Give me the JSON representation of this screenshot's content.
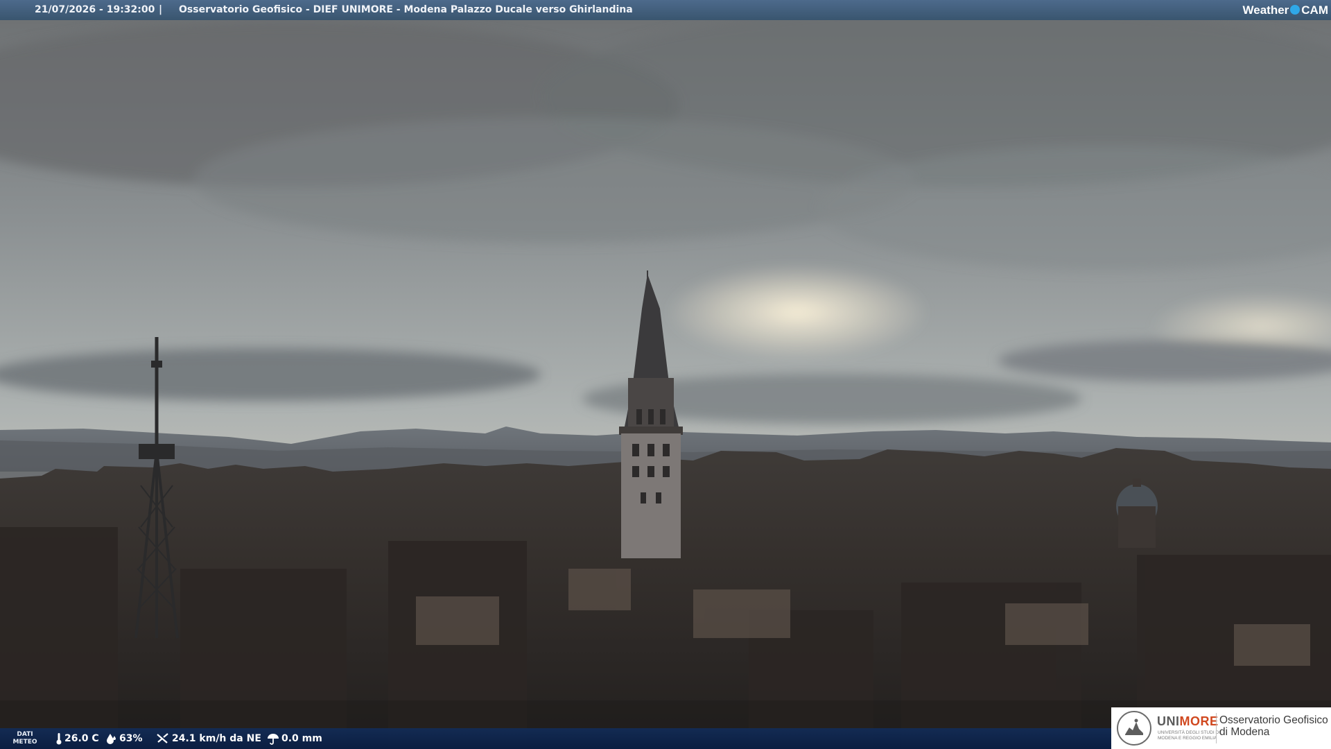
{
  "header": {
    "timestamp": "21/07/2026 - 19:32:00",
    "separator": "|",
    "title": "Osservatorio Geofisico - DIEF UNIMORE - Modena Palazzo Ducale verso Ghirlandina",
    "logo_word": "Weather",
    "logo_cam": "CAM"
  },
  "weather": {
    "label_line1": "DATI",
    "label_line2": "METEO",
    "temperature": "26.0 C",
    "humidity": "63%",
    "wind": "24.1 km/h da NE",
    "rain": "0.0 mm",
    "icons": [
      "thermometer-icon",
      "humidity-drop-icon",
      "wind-icon",
      "rain-umbrella-icon"
    ]
  },
  "branding": {
    "university_uni": "UNI",
    "university_more": "MORE",
    "university_sub": "UNIVERSITÀ DEGLI STUDI DI MODENA E REGGIO EMILIA",
    "observatory_line1": "Osservatorio Geofisico",
    "observatory_line2": "di Modena"
  },
  "colors": {
    "top_bar": "#43607f",
    "bottom_bar": "#122c58",
    "unimore_accent": "#d0481f"
  }
}
